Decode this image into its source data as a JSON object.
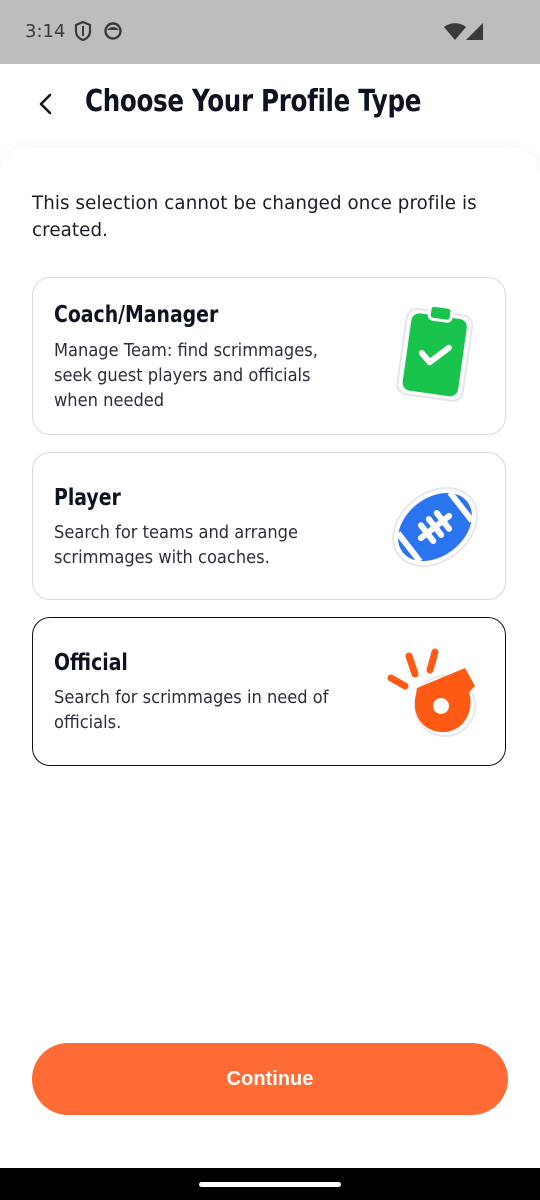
{
  "status_bar": {
    "time": "3:14",
    "icons": [
      "shield-icon",
      "face-icon",
      "wifi-icon",
      "signal-icon"
    ]
  },
  "header": {
    "back_icon": "chevron-left-icon",
    "title": "Choose Your Profile Type"
  },
  "intro_text": "This selection cannot be changed once profile is created.",
  "profile_types": [
    {
      "title": "Coach/Manager",
      "description": "Manage Team: find scrimmages, seek guest players and officials when needed",
      "icon": "clipboard-check-icon",
      "icon_color": "#18c44c",
      "selected": false
    },
    {
      "title": "Player",
      "description": "Search for teams and arrange scrimmages with coaches.",
      "icon": "football-icon",
      "icon_color": "#2a74f0",
      "selected": false
    },
    {
      "title": "Official",
      "description": "Search for scrimmages in need of officials.",
      "icon": "whistle-icon",
      "icon_color": "#ff5a14",
      "selected": true
    }
  ],
  "continue_label": "Continue",
  "colors": {
    "accent": "#ff6b35",
    "text": "#0e1320",
    "card_border": "#d5d8de",
    "selected_border": "#111111"
  }
}
